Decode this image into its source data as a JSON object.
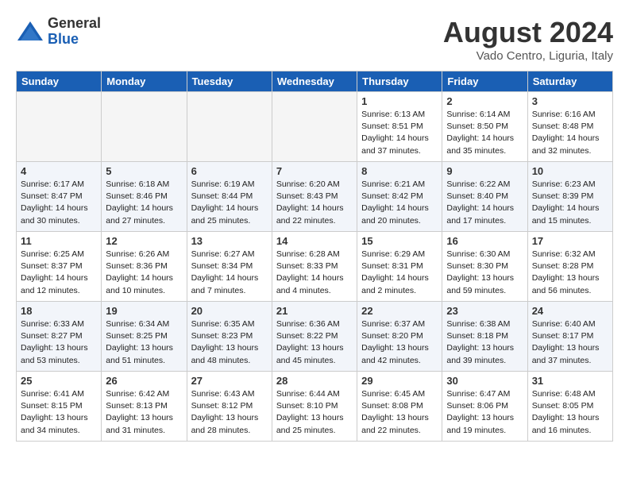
{
  "header": {
    "logo_general": "General",
    "logo_blue": "Blue",
    "month_year": "August 2024",
    "location": "Vado Centro, Liguria, Italy"
  },
  "weekdays": [
    "Sunday",
    "Monday",
    "Tuesday",
    "Wednesday",
    "Thursday",
    "Friday",
    "Saturday"
  ],
  "weeks": [
    [
      {
        "day": "",
        "info": ""
      },
      {
        "day": "",
        "info": ""
      },
      {
        "day": "",
        "info": ""
      },
      {
        "day": "",
        "info": ""
      },
      {
        "day": "1",
        "info": "Sunrise: 6:13 AM\nSunset: 8:51 PM\nDaylight: 14 hours and 37 minutes."
      },
      {
        "day": "2",
        "info": "Sunrise: 6:14 AM\nSunset: 8:50 PM\nDaylight: 14 hours and 35 minutes."
      },
      {
        "day": "3",
        "info": "Sunrise: 6:16 AM\nSunset: 8:48 PM\nDaylight: 14 hours and 32 minutes."
      }
    ],
    [
      {
        "day": "4",
        "info": "Sunrise: 6:17 AM\nSunset: 8:47 PM\nDaylight: 14 hours and 30 minutes."
      },
      {
        "day": "5",
        "info": "Sunrise: 6:18 AM\nSunset: 8:46 PM\nDaylight: 14 hours and 27 minutes."
      },
      {
        "day": "6",
        "info": "Sunrise: 6:19 AM\nSunset: 8:44 PM\nDaylight: 14 hours and 25 minutes."
      },
      {
        "day": "7",
        "info": "Sunrise: 6:20 AM\nSunset: 8:43 PM\nDaylight: 14 hours and 22 minutes."
      },
      {
        "day": "8",
        "info": "Sunrise: 6:21 AM\nSunset: 8:42 PM\nDaylight: 14 hours and 20 minutes."
      },
      {
        "day": "9",
        "info": "Sunrise: 6:22 AM\nSunset: 8:40 PM\nDaylight: 14 hours and 17 minutes."
      },
      {
        "day": "10",
        "info": "Sunrise: 6:23 AM\nSunset: 8:39 PM\nDaylight: 14 hours and 15 minutes."
      }
    ],
    [
      {
        "day": "11",
        "info": "Sunrise: 6:25 AM\nSunset: 8:37 PM\nDaylight: 14 hours and 12 minutes."
      },
      {
        "day": "12",
        "info": "Sunrise: 6:26 AM\nSunset: 8:36 PM\nDaylight: 14 hours and 10 minutes."
      },
      {
        "day": "13",
        "info": "Sunrise: 6:27 AM\nSunset: 8:34 PM\nDaylight: 14 hours and 7 minutes."
      },
      {
        "day": "14",
        "info": "Sunrise: 6:28 AM\nSunset: 8:33 PM\nDaylight: 14 hours and 4 minutes."
      },
      {
        "day": "15",
        "info": "Sunrise: 6:29 AM\nSunset: 8:31 PM\nDaylight: 14 hours and 2 minutes."
      },
      {
        "day": "16",
        "info": "Sunrise: 6:30 AM\nSunset: 8:30 PM\nDaylight: 13 hours and 59 minutes."
      },
      {
        "day": "17",
        "info": "Sunrise: 6:32 AM\nSunset: 8:28 PM\nDaylight: 13 hours and 56 minutes."
      }
    ],
    [
      {
        "day": "18",
        "info": "Sunrise: 6:33 AM\nSunset: 8:27 PM\nDaylight: 13 hours and 53 minutes."
      },
      {
        "day": "19",
        "info": "Sunrise: 6:34 AM\nSunset: 8:25 PM\nDaylight: 13 hours and 51 minutes."
      },
      {
        "day": "20",
        "info": "Sunrise: 6:35 AM\nSunset: 8:23 PM\nDaylight: 13 hours and 48 minutes."
      },
      {
        "day": "21",
        "info": "Sunrise: 6:36 AM\nSunset: 8:22 PM\nDaylight: 13 hours and 45 minutes."
      },
      {
        "day": "22",
        "info": "Sunrise: 6:37 AM\nSunset: 8:20 PM\nDaylight: 13 hours and 42 minutes."
      },
      {
        "day": "23",
        "info": "Sunrise: 6:38 AM\nSunset: 8:18 PM\nDaylight: 13 hours and 39 minutes."
      },
      {
        "day": "24",
        "info": "Sunrise: 6:40 AM\nSunset: 8:17 PM\nDaylight: 13 hours and 37 minutes."
      }
    ],
    [
      {
        "day": "25",
        "info": "Sunrise: 6:41 AM\nSunset: 8:15 PM\nDaylight: 13 hours and 34 minutes."
      },
      {
        "day": "26",
        "info": "Sunrise: 6:42 AM\nSunset: 8:13 PM\nDaylight: 13 hours and 31 minutes."
      },
      {
        "day": "27",
        "info": "Sunrise: 6:43 AM\nSunset: 8:12 PM\nDaylight: 13 hours and 28 minutes."
      },
      {
        "day": "28",
        "info": "Sunrise: 6:44 AM\nSunset: 8:10 PM\nDaylight: 13 hours and 25 minutes."
      },
      {
        "day": "29",
        "info": "Sunrise: 6:45 AM\nSunset: 8:08 PM\nDaylight: 13 hours and 22 minutes."
      },
      {
        "day": "30",
        "info": "Sunrise: 6:47 AM\nSunset: 8:06 PM\nDaylight: 13 hours and 19 minutes."
      },
      {
        "day": "31",
        "info": "Sunrise: 6:48 AM\nSunset: 8:05 PM\nDaylight: 13 hours and 16 minutes."
      }
    ]
  ]
}
